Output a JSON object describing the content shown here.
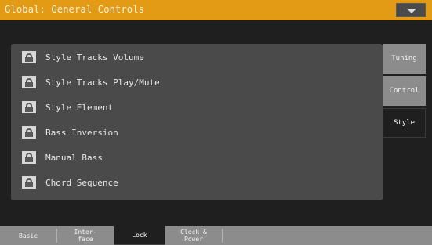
{
  "header": {
    "title": "Global: General Controls",
    "menu_icon": "chevron-down-icon"
  },
  "lock_items": [
    {
      "label": "Style Tracks Volume",
      "locked": false
    },
    {
      "label": "Style Tracks Play/Mute",
      "locked": false
    },
    {
      "label": "Style Element",
      "locked": true
    },
    {
      "label": "Bass Inversion",
      "locked": false
    },
    {
      "label": "Manual Bass",
      "locked": true
    },
    {
      "label": "Chord Sequence",
      "locked": false
    }
  ],
  "side_tabs": [
    {
      "label": "Tuning",
      "active": false
    },
    {
      "label": "Control",
      "active": false
    },
    {
      "label": "Style",
      "active": true
    }
  ],
  "bottom_tabs": [
    {
      "label": "Basic",
      "active": false
    },
    {
      "label": "Inter-\nface",
      "active": false
    },
    {
      "label": "Lock",
      "active": true
    },
    {
      "label": "Clock &\nPower",
      "active": false
    }
  ],
  "colors": {
    "title_bar": "#e39a14",
    "panel": "#4a4a4a",
    "tab_inactive": "#8c8c8c",
    "background": "#1f1f1f"
  }
}
